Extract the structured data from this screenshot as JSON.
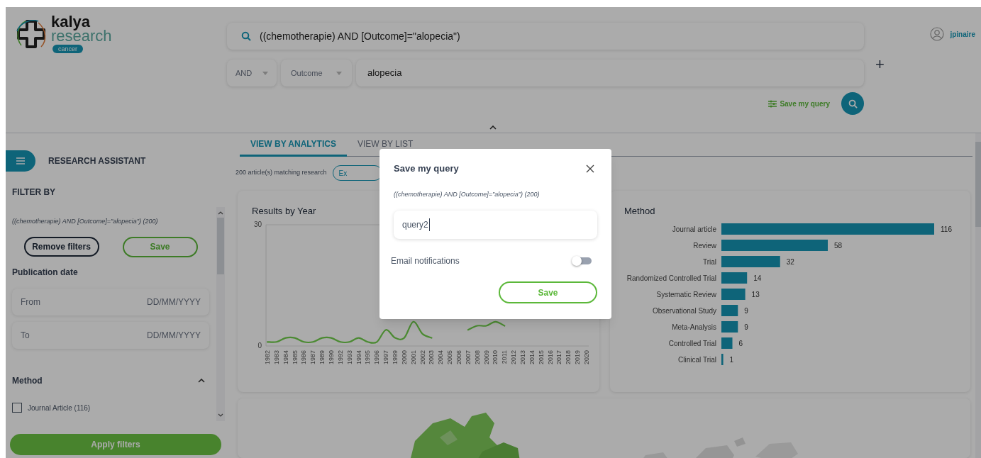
{
  "logo": {
    "name": "kalya",
    "tagline": "research",
    "badge": "cancer"
  },
  "search": {
    "query": "((chemotherapie) AND [Outcome]=\"alopecia\")"
  },
  "query_builder": {
    "operator": "AND",
    "field": "Outcome",
    "value": "alopecia",
    "add": "+"
  },
  "save_query_link": "Save my query",
  "user": {
    "name": "jpinaire"
  },
  "sidebar": {
    "title": "RESEARCH ASSISTANT",
    "filter_heading": "FILTER BY",
    "current_query": "((chemotherapie) AND [Outcome]=\"alopecia\") (200)",
    "buttons": [
      "Remove filters",
      "Save"
    ],
    "publication_date": {
      "heading": "Publication date",
      "fields": [
        {
          "label": "From",
          "placeholder": "DD/MM/YYYY"
        },
        {
          "label": "To",
          "placeholder": "DD/MM/YYYY"
        }
      ]
    },
    "method": {
      "heading": "Method",
      "expanded": true,
      "options": [
        {
          "label": "Journal Article (116)",
          "checked": false
        }
      ]
    },
    "apply_button": "Apply filters"
  },
  "tabs": [
    {
      "label": "VIEW BY ANALYTICS",
      "selected": true
    },
    {
      "label": "VIEW BY LIST",
      "selected": false
    }
  ],
  "results_count": "200 article(s) matching research",
  "export_button": "Ex",
  "results_by_year": {
    "chart_data": {
      "type": "line",
      "title": "Results by Year",
      "categories": [
        "1982",
        "1983",
        "1984",
        "1985",
        "1986",
        "1987",
        "1989",
        "1990",
        "1992",
        "1993",
        "1994",
        "1995",
        "1996",
        "1997",
        "1999",
        "2000",
        "2001",
        "2002",
        "2003",
        "2004",
        "2005",
        "2006",
        "2007",
        "2008",
        "2009",
        "2010",
        "2011",
        "2012",
        "2013",
        "2014",
        "2015",
        "2016",
        "2017",
        "2018",
        "2019",
        "2020"
      ],
      "series": [
        {
          "color": "#4b8a32",
          "values": [
            1,
            1,
            2,
            2,
            1,
            1,
            2,
            2,
            1,
            1,
            2,
            1,
            1,
            4,
            2,
            2,
            6,
            3,
            2,
            null,
            null,
            null,
            4,
            5,
            5,
            6,
            5,
            null,
            null,
            null,
            null,
            null,
            null,
            null,
            null,
            null
          ]
        }
      ],
      "ylim": [
        0,
        30
      ],
      "yticks": [
        0,
        30
      ]
    }
  },
  "method_chart": {
    "chart_data": {
      "type": "bar",
      "orientation": "horizontal",
      "title": "Method",
      "categories": [
        "Journal article",
        "Review",
        "Trial",
        "Randomized Controlled Trial",
        "Systematic Review",
        "Observational Study",
        "Meta-Analysis",
        "Controlled Trial",
        "Clinical Trial"
      ],
      "series": [
        {
          "color": "#1596b5",
          "values": [
            116,
            58,
            32,
            14,
            13,
            9,
            9,
            6,
            1
          ]
        }
      ],
      "data_labels": true
    }
  },
  "modal": {
    "title": "Save my query",
    "query": "((chemotherapie) AND [Outcome]=\"alopecia\") (200)",
    "name_value": "query2",
    "email_notifications": {
      "label": "Email notifications",
      "on": false
    },
    "save_button": "Save"
  }
}
